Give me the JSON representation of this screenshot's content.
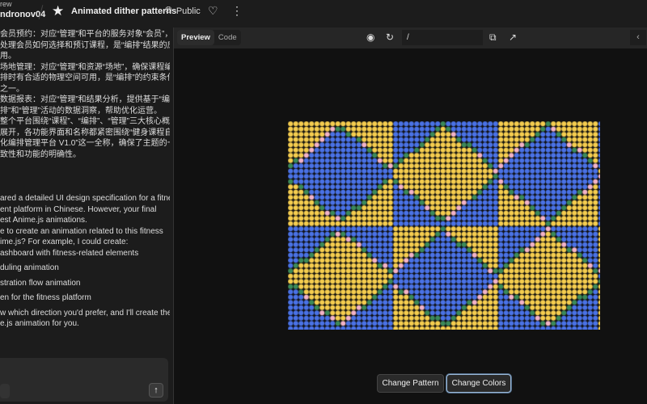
{
  "header": {
    "breadcrumb_small": "rew",
    "user": "ndronov04",
    "title": "Animated dither patterns",
    "visibility": "Public"
  },
  "chat": {
    "zh_lines": [
      "会员预约：对应“管理”和平台的服务对象“会员”，",
      "处理会员如何选择和预订课程，是“编排”结果的应",
      "用。",
      "场地管理：对应“管理”和资源“场地”，确保课程编",
      "排时有合适的物理空间可用，是“编排”的约束条件",
      "之一。",
      "数据报表：对应“管理”和结果分析，提供基于“编",
      "排”和“管理”活动的数据洞察，帮助优化运营。",
      "整个平台围绕“课程”、“编排”、“管理”三大核心概念",
      "展开，各功能界面和名称都紧密围绕“健身课程自动",
      "化编排管理平台 V1.0”这一全称，确保了主题的一",
      "致性和功能的明确性。"
    ],
    "en_lines": [
      "ared a detailed UI design specification for a fitness",
      "ent platform in Chinese. However, your final",
      "est Anime.js animations.",
      "e to create an animation related to this fitness",
      "ime.js? For example, I could create:"
    ],
    "options": [
      "ashboard with fitness-related elements",
      "duling animation",
      "stration flow animation",
      "en for the fitness platform"
    ],
    "closing": [
      "w which direction you'd prefer, and I'll create the",
      "e.js animation for you."
    ]
  },
  "preview": {
    "tab_preview": "Preview",
    "tab_code": "Code",
    "url": "/",
    "btn_pattern": "Change Pattern",
    "btn_colors": "Change Colors",
    "colors": {
      "yellow": "#f5cd4f",
      "blue": "#4a72e6",
      "green": "#3c8a5a",
      "pink": "#f2b3c8",
      "bg": "#111111"
    }
  }
}
